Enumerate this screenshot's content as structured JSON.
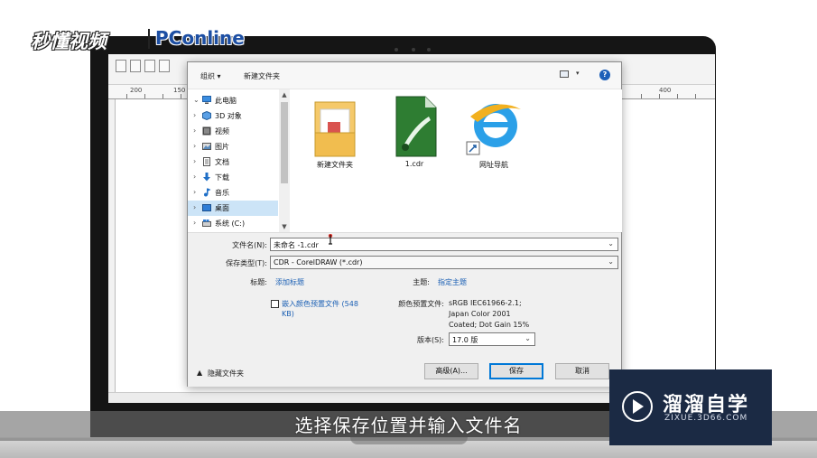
{
  "watermark": {
    "top_logo_left": "秒懂视频",
    "top_logo_right": "PConline",
    "brand_name": "溜溜自学",
    "brand_url": "ZIXUE.3D66.COM",
    "caption": "选择保存位置并输入文件名"
  },
  "ruler": {
    "left_num": "200",
    "mid_num": "150",
    "right_num": "400"
  },
  "dialog": {
    "toolbar": {
      "organize": "组织 ▾",
      "new_folder": "新建文件夹",
      "view_arrow": "▾",
      "help": "?"
    },
    "nav": [
      {
        "label": "此电脑",
        "icon": "computer-icon",
        "chevron": "⌄"
      },
      {
        "label": "3D 对象",
        "icon": "cube-icon",
        "chevron": "›"
      },
      {
        "label": "视频",
        "icon": "video-icon",
        "chevron": "›"
      },
      {
        "label": "图片",
        "icon": "picture-icon",
        "chevron": "›"
      },
      {
        "label": "文档",
        "icon": "document-icon",
        "chevron": "›"
      },
      {
        "label": "下载",
        "icon": "download-icon",
        "chevron": "›"
      },
      {
        "label": "音乐",
        "icon": "music-icon",
        "chevron": "›"
      },
      {
        "label": "桌面",
        "icon": "desktop-icon",
        "chevron": "›",
        "selected": true
      },
      {
        "label": "系统 (C:)",
        "icon": "drive-icon",
        "chevron": "›"
      }
    ],
    "files": [
      {
        "label": "新建文件夹",
        "icon": "folder-icon"
      },
      {
        "label": "1.cdr",
        "icon": "coreldraw-file-icon"
      },
      {
        "label": "网址导航",
        "icon": "internet-explorer-icon"
      }
    ],
    "form": {
      "filename_label": "文件名(N):",
      "filename_value": "未命名 -1.cdr",
      "savetype_label": "保存类型(T):",
      "savetype_value": "CDR - CorelDRAW (*.cdr)",
      "title_label": "标题:",
      "title_link": "添加标题",
      "subject_label": "主题:",
      "subject_link": "指定主题",
      "embed_label": "嵌入颜色预置文件 (548",
      "embed_label2": "KB)",
      "color_profile_label": "颜色预置文件:",
      "color_profile_value1": "sRGB IEC61966-2.1;",
      "color_profile_value2": "Japan Color 2001",
      "color_profile_value3": "Coated; Dot Gain 15%",
      "version_label": "版本(S):",
      "version_value": "17.0 版",
      "hide_folders": "隐藏文件夹",
      "advanced_button": "高级(A)...",
      "save_button": "保存",
      "cancel_button": "取消"
    }
  }
}
